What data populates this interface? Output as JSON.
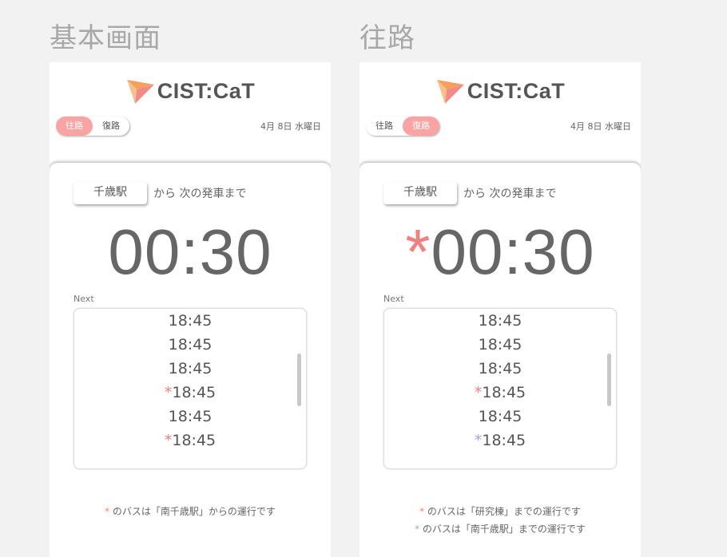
{
  "screens": [
    {
      "title": "基本画面",
      "app_name": "CIST:CaT",
      "toggle": {
        "outbound": "往路",
        "return": "復路",
        "active": "outbound"
      },
      "date": "4月 8日 水曜日",
      "station": "千歳駅",
      "from_label": "から 次の発車まで",
      "countdown": {
        "star": "",
        "time": "00:30"
      },
      "next_label": "Next",
      "times": [
        {
          "mark": "",
          "color": "",
          "time": "18:45"
        },
        {
          "mark": "",
          "color": "",
          "time": "18:45"
        },
        {
          "mark": "",
          "color": "",
          "time": "18:45"
        },
        {
          "mark": "*",
          "color": "red",
          "time": "18:45"
        },
        {
          "mark": "",
          "color": "",
          "time": "18:45"
        },
        {
          "mark": "*",
          "color": "red",
          "time": "18:45"
        }
      ],
      "notes": [
        {
          "mark": "*",
          "color": "red",
          "text": "のバスは「南千歳駅」からの運行です"
        }
      ]
    },
    {
      "title": "往路",
      "app_name": "CIST:CaT",
      "toggle": {
        "outbound": "往路",
        "return": "復路",
        "active": "return"
      },
      "date": "4月 8日 水曜日",
      "station": "千歳駅",
      "from_label": "から 次の発車まで",
      "countdown": {
        "star": "*",
        "time": "00:30"
      },
      "next_label": "Next",
      "times": [
        {
          "mark": "",
          "color": "",
          "time": "18:45"
        },
        {
          "mark": "",
          "color": "",
          "time": "18:45"
        },
        {
          "mark": "",
          "color": "",
          "time": "18:45"
        },
        {
          "mark": "*",
          "color": "red",
          "time": "18:45"
        },
        {
          "mark": "",
          "color": "",
          "time": "18:45"
        },
        {
          "mark": "*",
          "color": "blue",
          "time": "18:45"
        }
      ],
      "notes": [
        {
          "mark": "*",
          "color": "red",
          "text": "のバスは「研究棟」までの運行です"
        },
        {
          "mark": "*",
          "color": "blue",
          "text": "のバスは「南千歳駅」までの運行です"
        }
      ]
    }
  ],
  "colors": {
    "accent_pink": "#f9a3a3",
    "mark_red": "#f47f7f",
    "mark_blue": "#9aa4f4",
    "logo_orange": "#f6a05a",
    "logo_pink": "#f38a8a"
  }
}
